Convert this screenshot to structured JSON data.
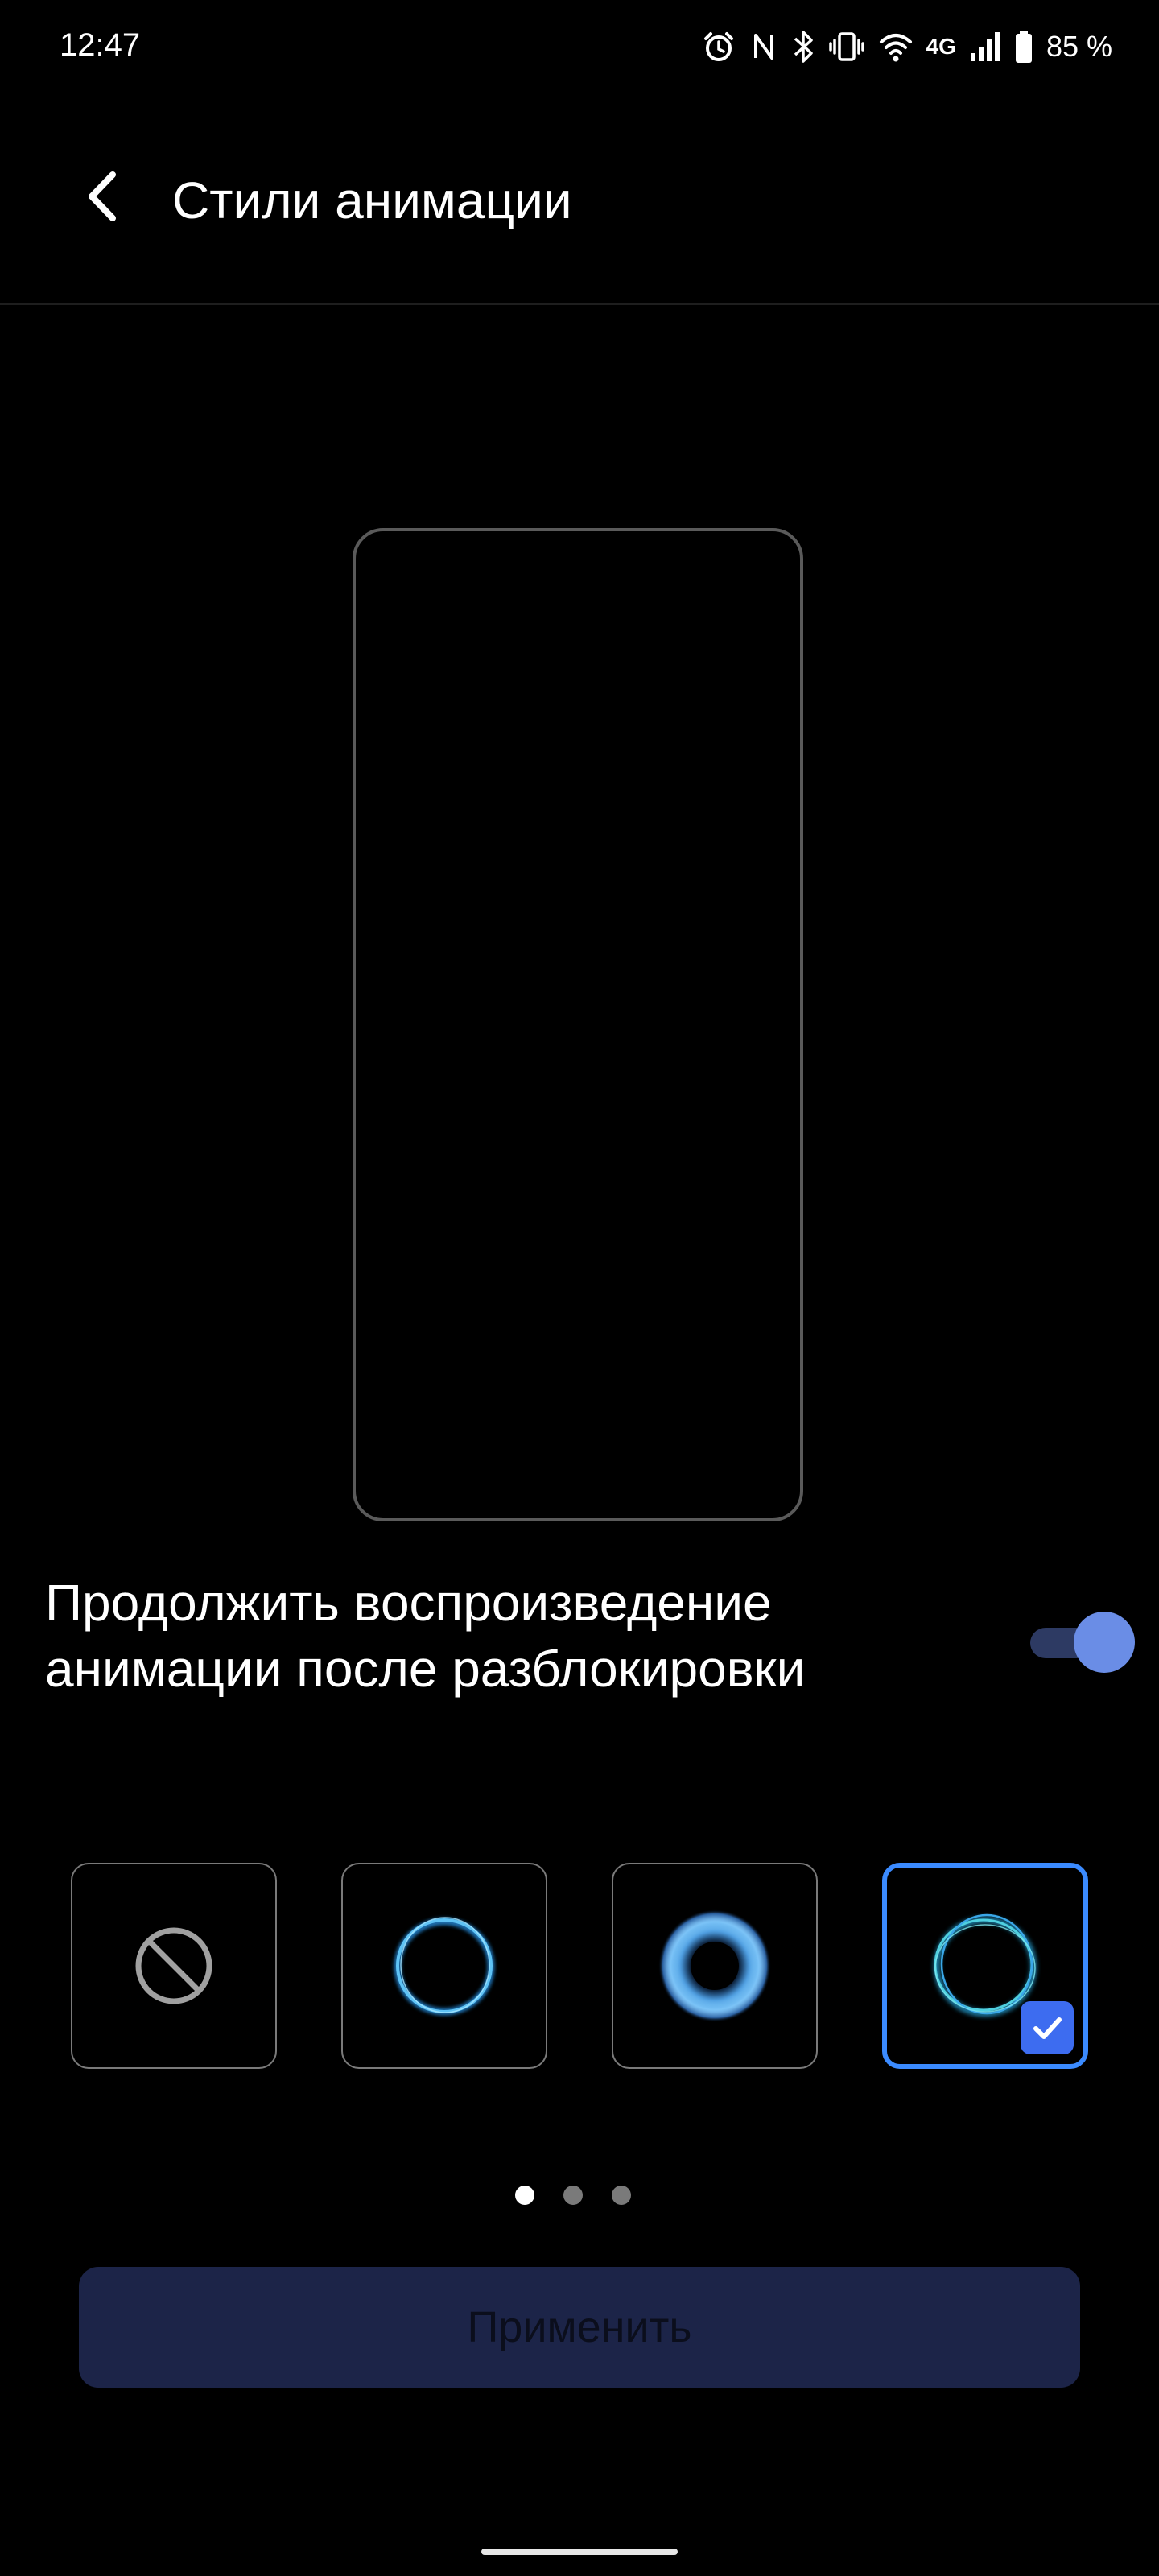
{
  "status_bar": {
    "time": "12:47",
    "icons": [
      "alarm-icon",
      "nfc-icon",
      "bluetooth-icon",
      "vibrate-icon",
      "wifi-icon",
      "signal-icon",
      "battery-icon"
    ],
    "network_label": "4G",
    "battery_percent": "85 %"
  },
  "header": {
    "back_icon": "chevron-left-icon",
    "title": "Стили анимации"
  },
  "setting": {
    "label": "Продолжить воспроизведение анимации после разблокировки",
    "enabled": true,
    "track_color": "#2d3a63",
    "thumb_color": "#6a8de6"
  },
  "styles": [
    {
      "name": "none",
      "icon": "no-animation-icon",
      "selected": false
    },
    {
      "name": "ring-thin",
      "icon": "ring-animation-icon",
      "selected": false
    },
    {
      "name": "ring-glow",
      "icon": "glow-ring-animation-icon",
      "selected": false
    },
    {
      "name": "ring-wave",
      "icon": "wave-ring-animation-icon",
      "selected": true
    }
  ],
  "pager": {
    "total": 3,
    "current": 1
  },
  "apply_button": {
    "label": "Применить"
  },
  "colors": {
    "accent": "#3b8bff",
    "check_badge": "#3d6cf0",
    "apply_bg": "#1c2448"
  }
}
